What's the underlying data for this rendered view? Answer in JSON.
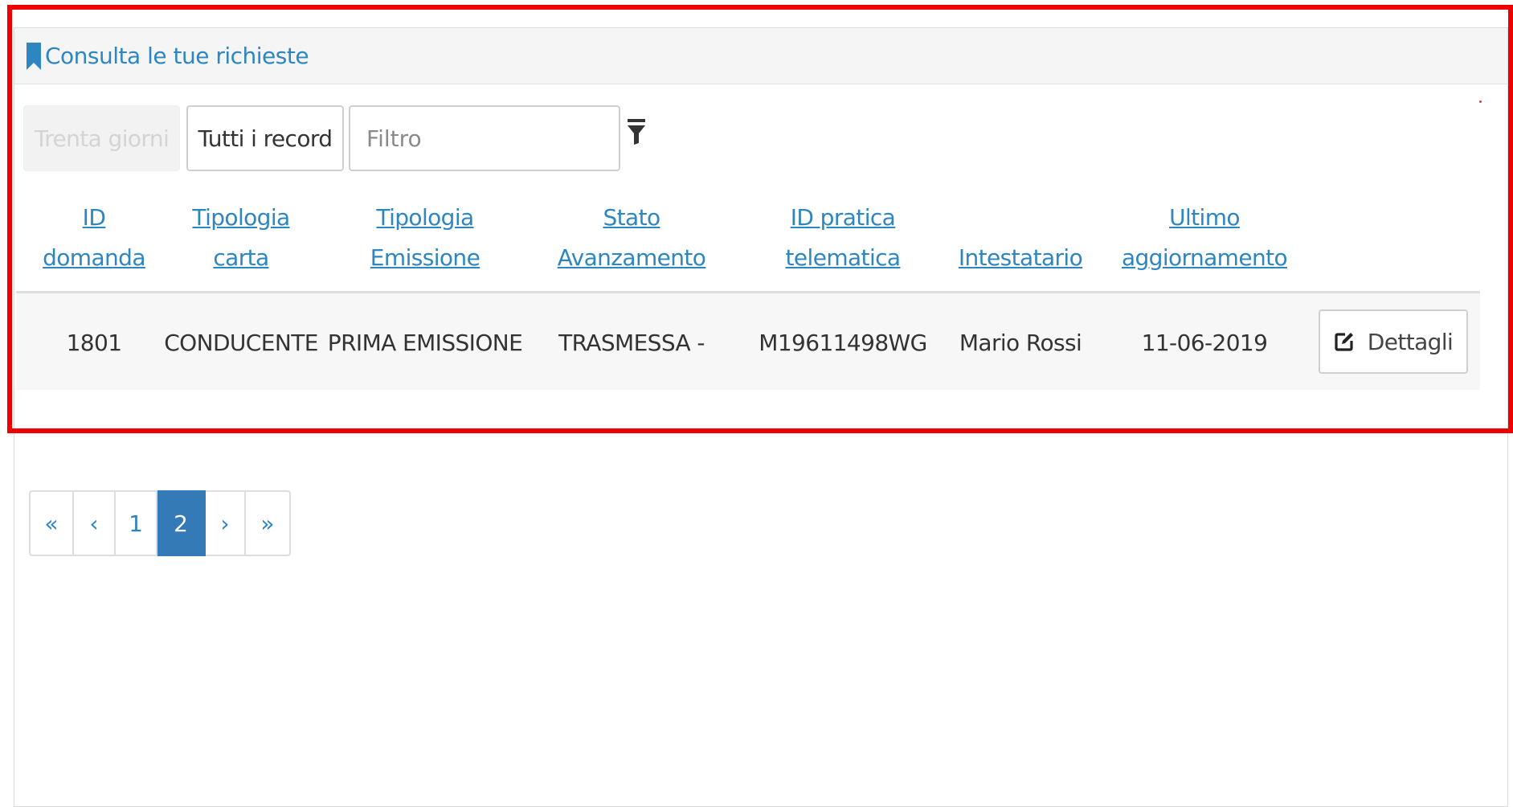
{
  "panel": {
    "title": "Consulta le tue richieste"
  },
  "toolbar": {
    "thirty_days_label": "Trenta giorni",
    "all_records_label": "Tutti i record",
    "filter_placeholder": "Filtro"
  },
  "table": {
    "columns": [
      {
        "label": "ID\ndomanda"
      },
      {
        "label": "Tipologia\ncarta"
      },
      {
        "label": "Tipologia\nEmissione"
      },
      {
        "label": "Stato\nAvanzamento"
      },
      {
        "label": "ID pratica\ntelematica"
      },
      {
        "label": "Intestatario"
      },
      {
        "label": "Ultimo\naggiornamento"
      }
    ],
    "rows": [
      {
        "id_domanda": "1801",
        "tipologia_carta": "CONDUCENTE",
        "tipologia_emissione": "PRIMA EMISSIONE",
        "stato_avanzamento": "TRASMESSA -",
        "id_pratica": "M19611498WG",
        "intestatario": "Mario Rossi",
        "ultimo_aggiornamento": "11-06-2019",
        "details_label": "Dettagli"
      }
    ]
  },
  "pagination": {
    "first": "«",
    "prev": "‹",
    "pages": [
      "1",
      "2"
    ],
    "active_page": "2",
    "next": "›",
    "last": "»"
  },
  "colors": {
    "accent": "#2e86c1",
    "active_page": "#337ab7",
    "highlight": "#ee0000"
  },
  "icons": {
    "title_icon": "bookmark-icon",
    "filter_icon": "filter-icon",
    "details_icon": "edit-icon"
  }
}
